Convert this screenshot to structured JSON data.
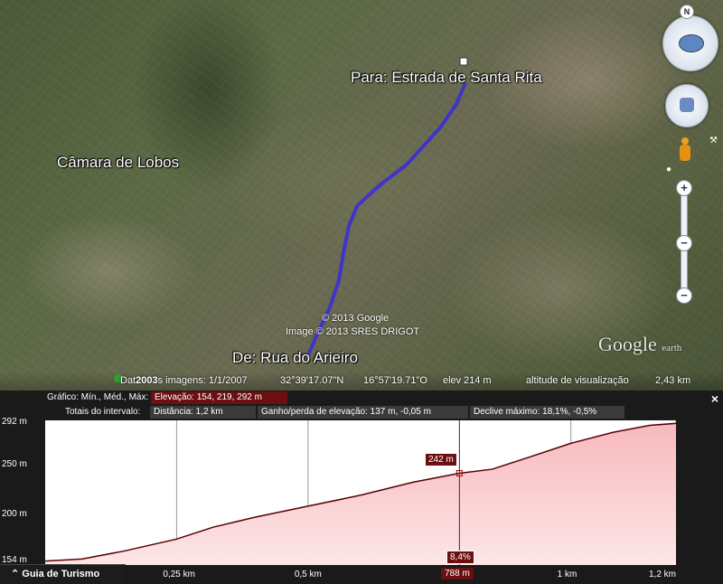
{
  "map": {
    "labels": {
      "destination": "Para: Estrada de Santa Rita",
      "town": "Câmara de Lobos",
      "origin": "De: Rua do Arieiro"
    },
    "credits": {
      "copyright": "© 2013 Google",
      "image_credit": "Image © 2013 SRES DRIGOT",
      "logo_main": "Google",
      "logo_sub": "earth"
    },
    "status": {
      "date_prefix": "Dat",
      "year": "2003",
      "imagery": "s imagens: 1/1/2007",
      "lat": "32°39'17.07\"N",
      "lon": "16°57'19.71\"O",
      "elev_label": "elev",
      "elev_value": "214 m",
      "eye_alt": "altitude de visualização",
      "eye_alt_value": "2,43 km"
    },
    "compass_north": "N"
  },
  "panel": {
    "graph_label": "Gráfico: Mín., Méd., Máx:",
    "elevation_box": "Elevação: 154, 219, 292 m",
    "totals_label": "Totais do intervalo:",
    "distance_box": "Distância: 1,2 km",
    "gain_box": "Ganho/perda de elevação: 137 m, -0,05 m",
    "slope_box": "Declive máximo: 18,1%, -0,5%",
    "close": "×",
    "marker_elev": "242 m",
    "marker_pct": "8,4%",
    "marker_x": "788 m",
    "tour_guide": "Guia de Turismo",
    "tour_icon": "⌃"
  },
  "colors": {
    "route": "#3b2fd6",
    "profile_line": "#5a0000",
    "profile_fill": "#f7b9bd",
    "panel_red": "#6b0f10"
  },
  "chart_data": {
    "type": "area",
    "title": "",
    "xlabel": "",
    "ylabel": "",
    "y_ticks": [
      "292 m",
      "250 m",
      "200 m",
      "154 m"
    ],
    "x_ticks": [
      "0,25 km",
      "0,5 km",
      "1 km",
      "1,2 km"
    ],
    "xlim": [
      0,
      1.2
    ],
    "ylim": [
      150,
      295
    ],
    "grid": true,
    "series": [
      {
        "x": [
          0.0,
          0.07,
          0.15,
          0.25,
          0.32,
          0.4,
          0.5,
          0.6,
          0.7,
          0.788,
          0.85,
          0.92,
          1.0,
          1.08,
          1.15,
          1.2
        ],
        "values": [
          154,
          156,
          164,
          176,
          188,
          198,
          209,
          220,
          233,
          242,
          246,
          258,
          272,
          283,
          290,
          292
        ]
      }
    ],
    "marker": {
      "x": 0.788,
      "y": 242
    }
  }
}
